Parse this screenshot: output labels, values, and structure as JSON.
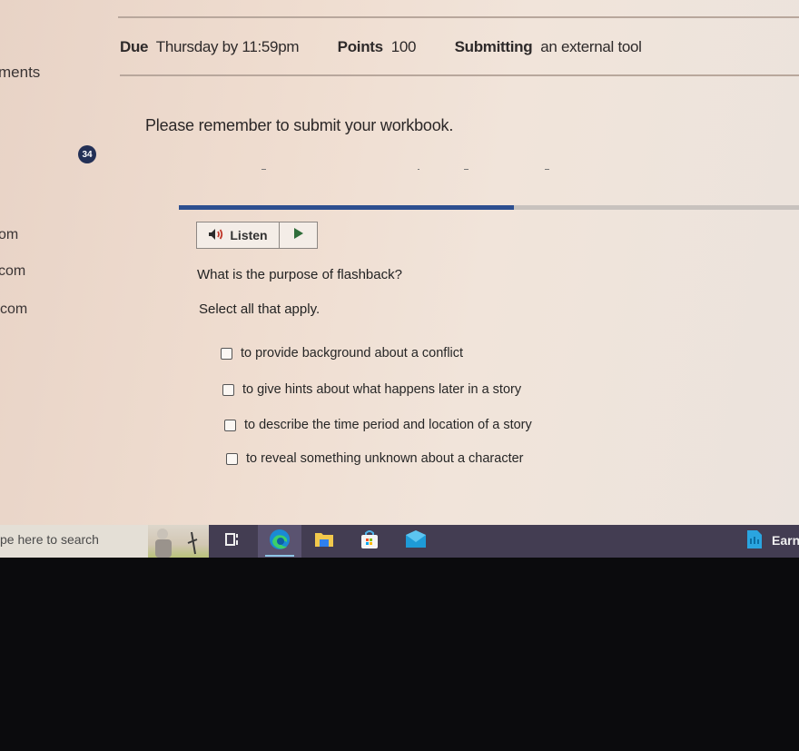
{
  "assignment": {
    "due_label": "Due",
    "due_value": "Thursday by 11:59pm",
    "points_label": "Points",
    "points_value": "100",
    "submitting_label": "Submitting",
    "submitting_value": "an external tool",
    "notice": "Please remember to submit your workbook."
  },
  "left_sidebar_fragments": [
    "ments",
    "om",
    "com",
    "com"
  ],
  "quiz": {
    "question_number": "34",
    "progress_percent": 54,
    "listen_label": "Listen",
    "question": "What is the purpose of flashback?",
    "instruction": "Select all that apply.",
    "options": [
      {
        "label": "to provide background about a conflict",
        "checked": false
      },
      {
        "label": "to give hints about what happens later in a story",
        "checked": false
      },
      {
        "label": "to describe the time period and location of a story",
        "checked": false
      },
      {
        "label": "to reveal something unknown about a character",
        "checked": false
      }
    ]
  },
  "taskbar": {
    "search_placeholder": "pe here to search",
    "apps": [
      "task-view",
      "edge",
      "file-explorer",
      "microsoft-store",
      "mail"
    ],
    "active_app": "edge",
    "tray_label": "Earn"
  }
}
